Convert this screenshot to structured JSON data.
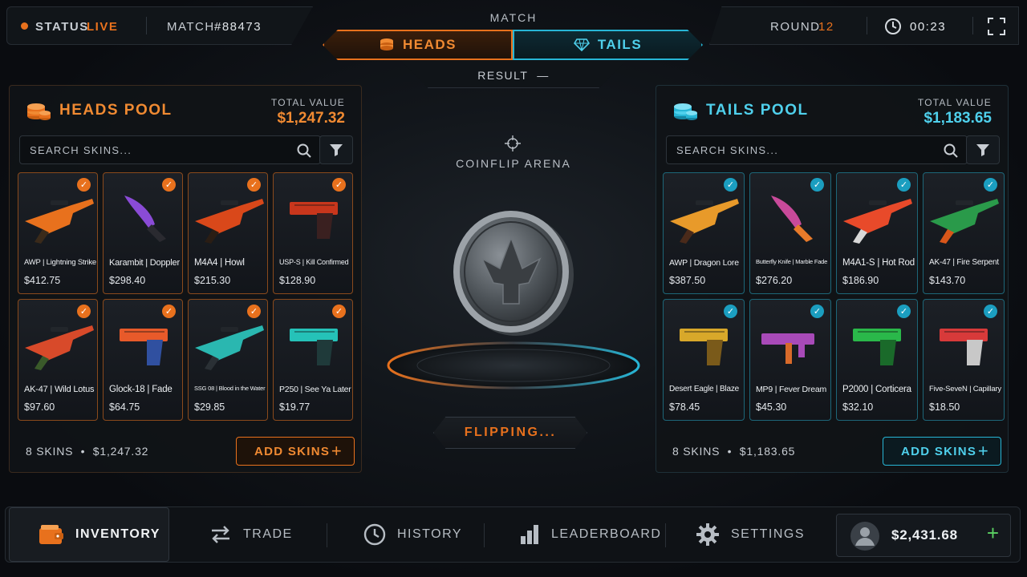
{
  "top_bar": {
    "status_label": "STATUS",
    "status_value": "LIVE",
    "match_label": "MATCH",
    "match_id": "#88473",
    "center_label": "MATCH",
    "heads_label": "HEADS",
    "tails_label": "TAILS",
    "result_label": "RESULT",
    "result_value": "—",
    "round_label": "ROUND",
    "round_value": "12",
    "timer": "00:23"
  },
  "heads_pool": {
    "title": "HEADS POOL",
    "total_label": "TOTAL VALUE",
    "total_value": "$1,247.32",
    "search_placeholder": "SEARCH SKINS...",
    "skins": [
      {
        "name": "AWP | Lightning Strike",
        "price": "$412.75"
      },
      {
        "name": "Karambit | Doppler",
        "price": "$298.40"
      },
      {
        "name": "M4A4 | Howl",
        "price": "$215.30"
      },
      {
        "name": "USP-S | Kill Confirmed",
        "price": "$128.90"
      },
      {
        "name": "AK-47 | Wild Lotus",
        "price": "$97.60"
      },
      {
        "name": "Glock-18 | Fade",
        "price": "$64.75"
      },
      {
        "name": "SSG 08 | Blood in the Water",
        "price": "$29.85"
      },
      {
        "name": "P250 | See Ya Later",
        "price": "$19.77"
      }
    ],
    "footer_count": "8 SKINS",
    "footer_value": "$1,247.32",
    "add_label": "ADD SKINS",
    "accent": "#e8711d"
  },
  "tails_pool": {
    "title": "TAILS POOL",
    "total_label": "TOTAL VALUE",
    "total_value": "$1,183.65",
    "search_placeholder": "SEARCH SKINS...",
    "skins": [
      {
        "name": "AWP | Dragon Lore",
        "price": "$387.50"
      },
      {
        "name": "Butterfly Knife | Marble Fade",
        "price": "$276.20"
      },
      {
        "name": "M4A1-S | Hot Rod",
        "price": "$186.90"
      },
      {
        "name": "AK-47 | Fire Serpent",
        "price": "$143.70"
      },
      {
        "name": "Desert Eagle | Blaze",
        "price": "$78.45"
      },
      {
        "name": "MP9 | Fever Dream",
        "price": "$45.30"
      },
      {
        "name": "P2000 | Corticera",
        "price": "$32.10"
      },
      {
        "name": "Five-SeveN | Capillary",
        "price": "$18.50"
      }
    ],
    "footer_count": "8 SKINS",
    "footer_value": "$1,183.65",
    "add_label": "ADD SKINS",
    "accent": "#27b6d6"
  },
  "arena": {
    "title": "COINFLIP ARENA",
    "status": "FLIPPING..."
  },
  "nav": {
    "items": [
      {
        "label": "INVENTORY",
        "icon": "wallet-icon"
      },
      {
        "label": "TRADE",
        "icon": "swap-icon"
      },
      {
        "label": "HISTORY",
        "icon": "clock-icon"
      },
      {
        "label": "LEADERBOARD",
        "icon": "bar-chart-icon"
      },
      {
        "label": "SETTINGS",
        "icon": "gear-icon"
      }
    ],
    "balance": "$2,431.68"
  }
}
